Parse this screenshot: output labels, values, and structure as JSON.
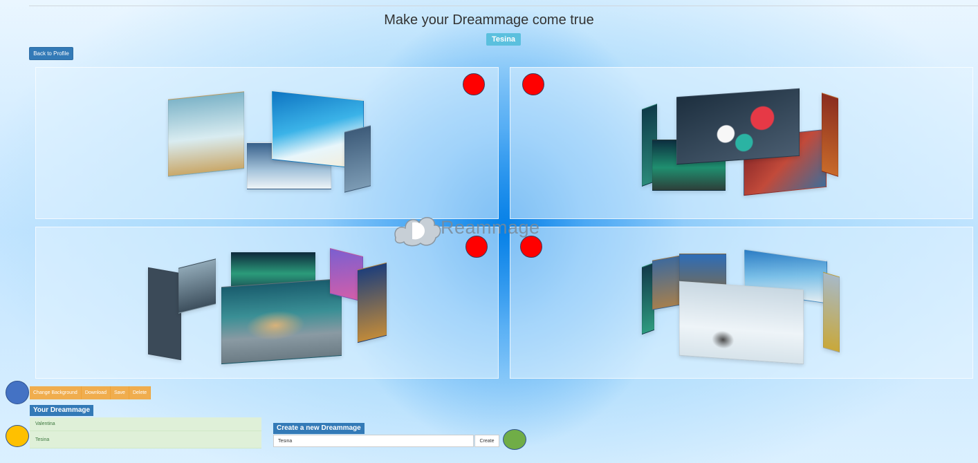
{
  "header": {
    "title": "Make your Dreammage come true",
    "badge": "Tesina"
  },
  "nav": {
    "back_label": "Back to Profile"
  },
  "logo": {
    "text": "Reammage"
  },
  "toolbar": {
    "items": [
      {
        "label": "Change Background"
      },
      {
        "label": "Download"
      },
      {
        "label": "Save"
      },
      {
        "label": "Delete"
      }
    ]
  },
  "your_dreammage": {
    "heading": "Your Dreammage",
    "items": [
      {
        "label": "Valentina"
      },
      {
        "label": "Tesina"
      }
    ]
  },
  "create": {
    "heading": "Create a new Dreammage",
    "input_value": "Tesina",
    "button_label": "Create"
  },
  "colors": {
    "primary": "#337ab7",
    "warning": "#f0ad4e",
    "info": "#5bc0de",
    "success_bg": "#dff0d8",
    "hotspot_red": "#ff0000",
    "marker_blue": "#4472c4",
    "marker_yellow": "#ffc000",
    "marker_green": "#70ad47"
  }
}
